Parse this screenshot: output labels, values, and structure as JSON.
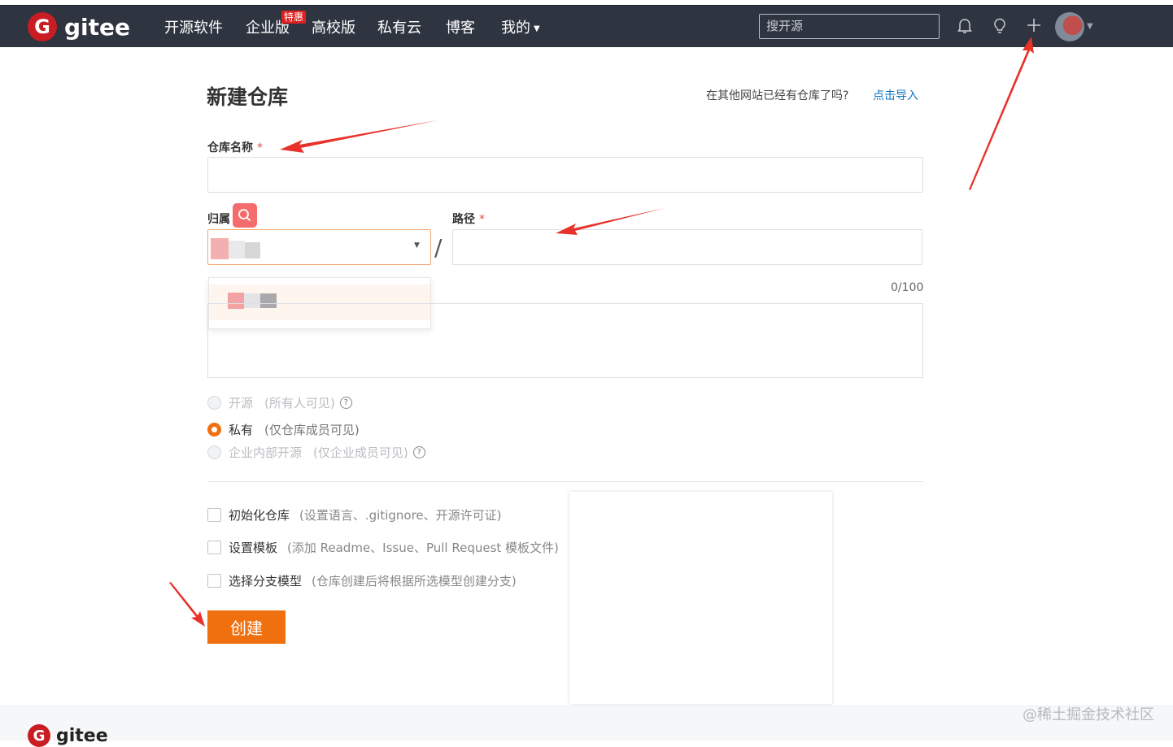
{
  "topbar": {
    "brand": "gitee",
    "brand_mark": "G",
    "nav": [
      {
        "label": "开源软件"
      },
      {
        "label": "企业版",
        "tag": "特惠"
      },
      {
        "label": "高校版"
      },
      {
        "label": "私有云"
      },
      {
        "label": "博客"
      },
      {
        "label": "我的"
      }
    ],
    "search_placeholder": "搜开源",
    "icons": [
      "bell-icon",
      "lightbulb-icon",
      "plus-icon",
      "avatar"
    ]
  },
  "page": {
    "title": "新建仓库",
    "import_question": "在其他网站已经有仓库了吗?",
    "import_link": "点击导入"
  },
  "form": {
    "repo_name_label": "仓库名称",
    "required_mark": "*",
    "owner_label": "归属",
    "path_label": "路径",
    "separator": "/",
    "description_counter": "0/100",
    "visibility": [
      {
        "label": "开源",
        "hint": "(所有人可见)",
        "selected": false,
        "disabled": true,
        "help": true
      },
      {
        "label": "私有",
        "hint": "(仅仓库成员可见)",
        "selected": true,
        "disabled": false,
        "help": false
      },
      {
        "label": "企业内部开源",
        "hint": "(仅企业成员可见)",
        "selected": false,
        "disabled": true,
        "help": true
      }
    ],
    "options": [
      {
        "label": "初始化仓库",
        "hint": "(设置语言、.gitignore、开源许可证)"
      },
      {
        "label": "设置模板",
        "hint": "(添加 Readme、Issue、Pull Request 模板文件)"
      },
      {
        "label": "选择分支模型",
        "hint": "(仓库创建后将根据所选模型创建分支)"
      }
    ],
    "submit_label": "创建"
  },
  "footer": {
    "brand": "gitee",
    "brand_mark": "G"
  },
  "watermark": "@稀土掘金技术社区",
  "colors": {
    "topbar": "#2e3440",
    "accent": "#f0700f",
    "link": "#0a73c2",
    "annotation_arrow": "#e8322b"
  }
}
